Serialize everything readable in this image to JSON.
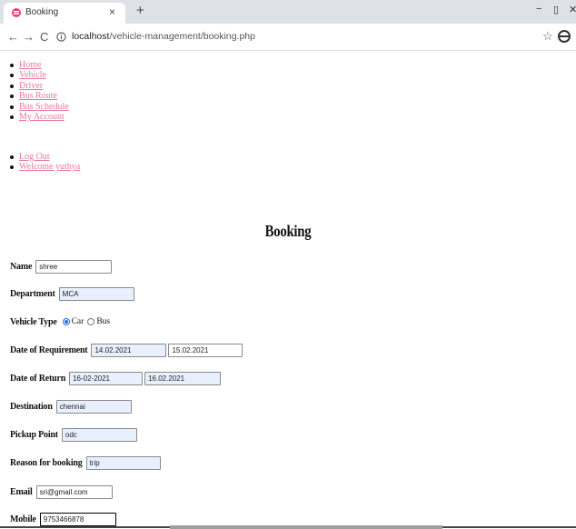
{
  "browser": {
    "tab_title": "Booking",
    "tab_close": "×",
    "new_tab": "+",
    "url_host": "localhost",
    "url_path": "/vehicle-management/booking.php",
    "back": "←",
    "forward": "→",
    "reload": "C",
    "star": "☆",
    "minimize": "−",
    "restore": "▯",
    "close": "✕",
    "favicon_color": "#e8417a"
  },
  "nav": {
    "items": [
      "Home",
      "Vehicle",
      "Driver",
      "Bus Route",
      "Bus Schedule",
      "My Account"
    ],
    "items2": [
      "Log Out",
      "Welcome yuthya"
    ],
    "link_color": "#e8789d"
  },
  "page": {
    "title": "Booking"
  },
  "form": {
    "name": {
      "label": "Name",
      "value": "shree"
    },
    "department": {
      "label": "Department",
      "value": "MCA"
    },
    "vehicle_type": {
      "label": "Vehicle Type",
      "options": [
        "Car",
        "Bus"
      ],
      "selected": "Car"
    },
    "date_req": {
      "label": "Date of Requirement",
      "from": "14.02.2021",
      "to": "15.02.2021"
    },
    "date_ret": {
      "label": "Date of Return",
      "from": "16-02-2021",
      "to": "16.02.2021"
    },
    "destination": {
      "label": "Destination",
      "value": "chennai"
    },
    "pickup": {
      "label": "Pickup Point",
      "value": "odc"
    },
    "reason": {
      "label": "Reason for booking",
      "value": "trip"
    },
    "email": {
      "label": "Email",
      "value": "sri@gmail.com"
    },
    "mobile": {
      "label": "Mobile",
      "value": "9753466878"
    }
  }
}
